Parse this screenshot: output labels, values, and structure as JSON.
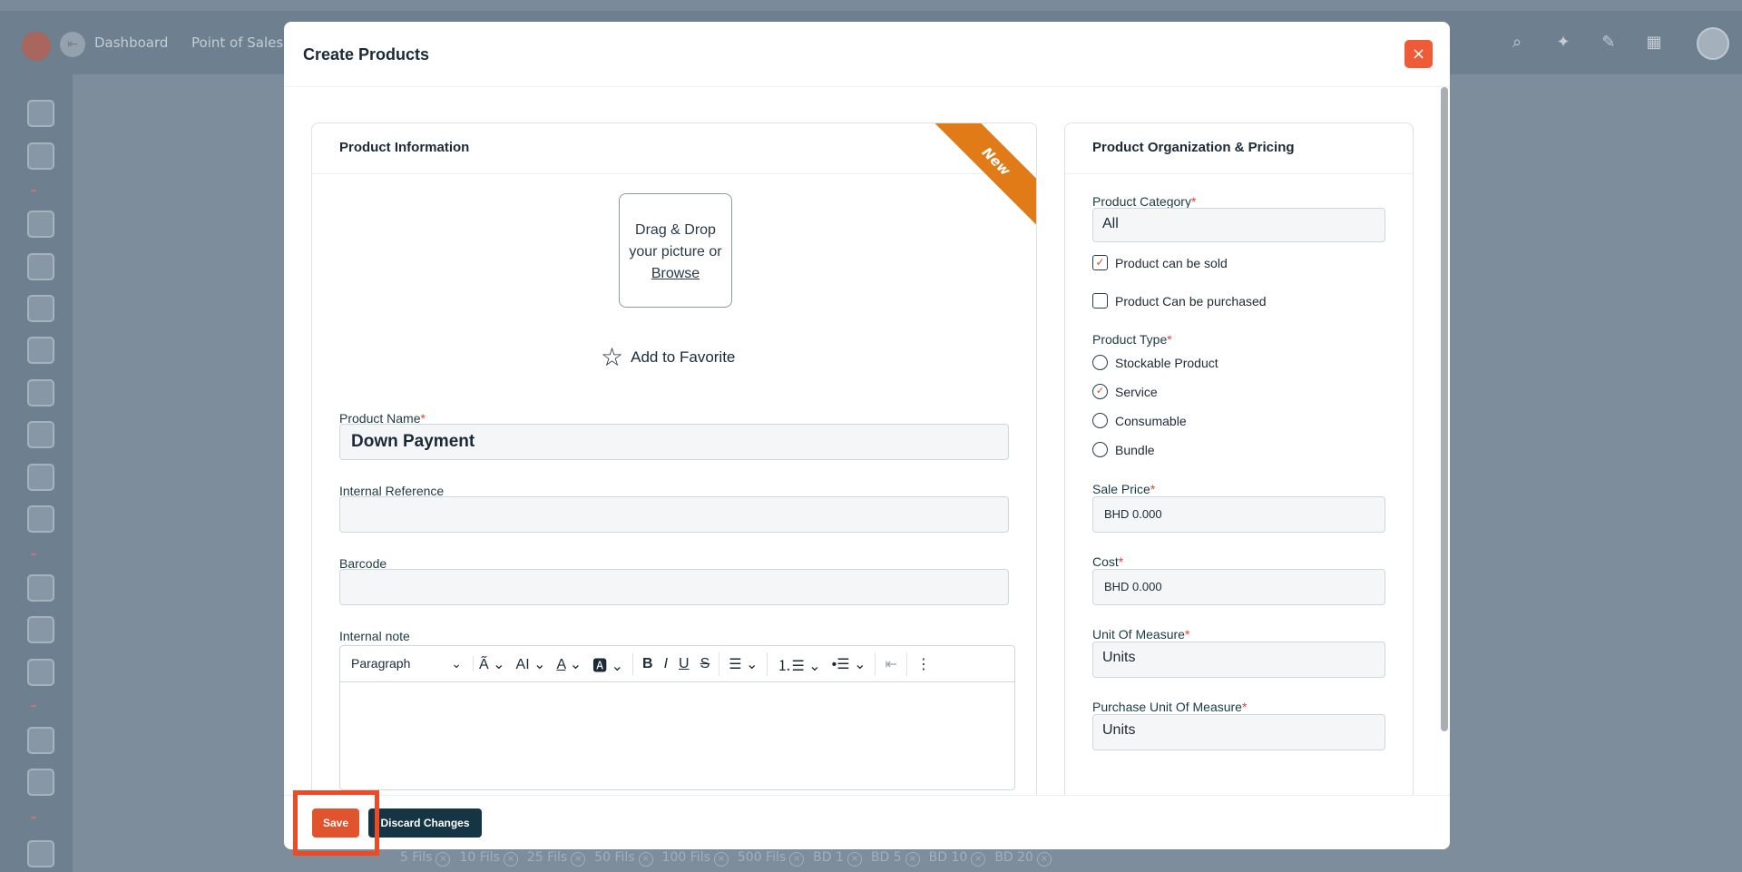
{
  "app": {
    "nav_dashboard": "Dashboard",
    "nav_pos": "Point of Sales",
    "chips": [
      "5 Fils",
      "10 Fils",
      "25 Fils",
      "50 Fils",
      "100 Fils",
      "500 Fils",
      "BD 1",
      "BD 5",
      "BD 10",
      "BD 20"
    ]
  },
  "modal": {
    "title": "Create Products",
    "close_icon": "×"
  },
  "product_info": {
    "heading": "Product Information",
    "ribbon": "New",
    "dropzone_line1": "Drag & Drop",
    "dropzone_line2": "your picture or",
    "dropzone_browse": "Browse",
    "favorite_label": "Add to Favorite",
    "name_label": "Product Name",
    "name_value": "Down Payment",
    "internal_ref_label": "Internal Reference",
    "internal_ref_value": "",
    "barcode_label": "Barcode",
    "barcode_value": "",
    "note_label": "Internal note",
    "editor_style": "Paragraph"
  },
  "organization": {
    "heading": "Product Organization & Pricing",
    "category_label": "Product Category",
    "category_value": "All",
    "can_be_sold_label": "Product can be sold",
    "can_be_sold": true,
    "can_be_purchased_label": "Product Can be purchased",
    "can_be_purchased": false,
    "type_label": "Product Type",
    "types": [
      {
        "label": "Stockable Product",
        "selected": false
      },
      {
        "label": "Service",
        "selected": true
      },
      {
        "label": "Consumable",
        "selected": false
      },
      {
        "label": "Bundle",
        "selected": false
      }
    ],
    "sale_price_label": "Sale Price",
    "sale_price_value": "BHD 0.000",
    "cost_label": "Cost",
    "cost_value": "BHD 0.000",
    "uom_label": "Unit Of Measure",
    "uom_value": "Units",
    "purchase_uom_label": "Purchase Unit Of Measure",
    "purchase_uom_value": "Units"
  },
  "footer": {
    "save_label": "Save",
    "discard_label": "Discard Changes"
  },
  "colors": {
    "accent": "#e0532d",
    "dark": "#153545",
    "ribbon": "#e07b18"
  }
}
